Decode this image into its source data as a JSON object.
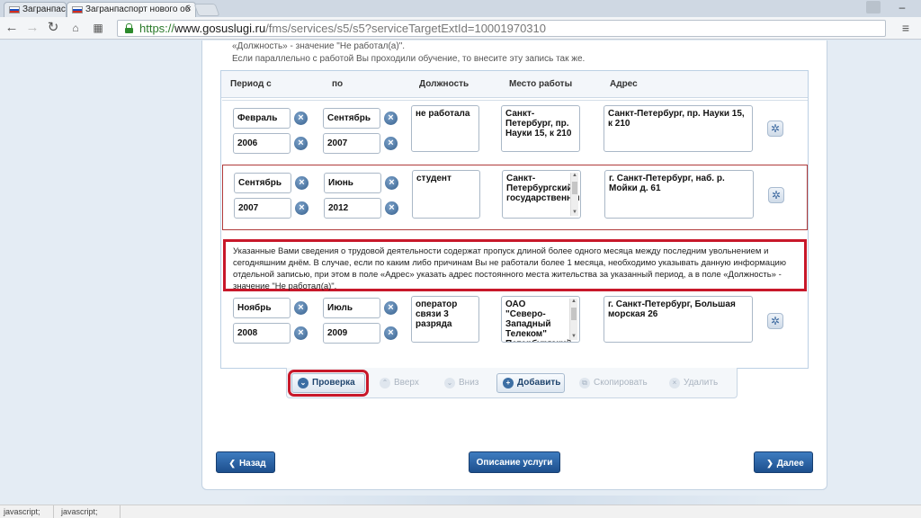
{
  "browser": {
    "tabs": [
      {
        "title": "Загранпас"
      },
      {
        "title": "Загранпаспорт нового об"
      }
    ],
    "url": {
      "green": "https://",
      "domain": "www.gosuslugi.ru",
      "path": "/fms/services/s5/s5?serviceTargetExtId=10001970310"
    },
    "status_left": "javascript;",
    "status_right": "javascript;"
  },
  "intro": {
    "line1": "«Должность» - значение \"Не работал(а)\".",
    "line2": "Если параллельно с работой Вы проходили обучение, то внесите эту запись так же."
  },
  "table": {
    "headers": [
      "Период с",
      "по",
      "Должность",
      "Место работы",
      "Адрес"
    ],
    "rows": [
      {
        "from_month": "Февраль",
        "from_year": "2006",
        "to_month": "Сентябрь",
        "to_year": "2007",
        "position": "не работала",
        "workplace": "Санкт-Петербург, пр. Науки 15, к 210",
        "address": "Санкт-Петербург, пр. Науки 15, к 210"
      },
      {
        "from_month": "Сентябрь",
        "from_year": "2007",
        "to_month": "Июнь",
        "to_year": "2012",
        "position": "студент",
        "workplace": "Санкт-Петербургский государственный",
        "address": "г. Санкт-Петербург, наб. р. Мойки д. 61"
      },
      {
        "from_month": "Ноябрь",
        "from_year": "2008",
        "to_month": "Июль",
        "to_year": "2009",
        "position": "оператор связи 3 разряда",
        "workplace": "ОАО \"Северо-Западный Телеком\" Петербургский",
        "address": "г. Санкт-Петербург, Большая морская 26"
      }
    ],
    "warning": "Указанные Вами сведения о трудовой деятельности содержат пропуск длиной более одного месяца между последним увольнением и сегодняшним днём. В случае, если по каким либо причинам Вы не работали более 1 месяца, необходимо указывать данную информацию отдельной записью, при этом в поле «Адрес» указать адрес постоянного места жительства за указанный период, а в поле «Должность» - значение \"Не работал(а)\"."
  },
  "actions": {
    "check": "Проверка",
    "up": "Вверх",
    "down": "Вниз",
    "add": "Добавить",
    "copy": "Скопировать",
    "delete": "Удалить"
  },
  "nav": {
    "back": "Назад",
    "description": "Описание услуги",
    "next": "Далее"
  }
}
